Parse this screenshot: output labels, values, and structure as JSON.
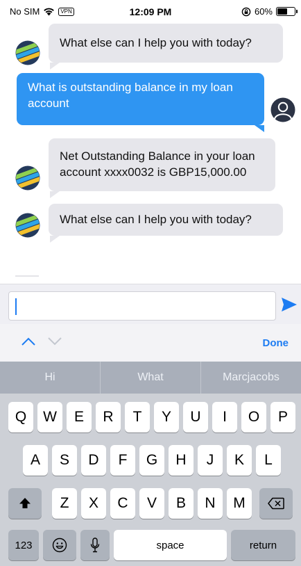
{
  "status_bar": {
    "carrier": "No SIM",
    "vpn": "VPN",
    "time": "12:09 PM",
    "battery": "60%",
    "battery_level": 0.6
  },
  "messages": [
    {
      "sender": "bot",
      "text": "What else can I help you with today?"
    },
    {
      "sender": "user",
      "text": "What is outstanding balance in my loan account"
    },
    {
      "sender": "bot",
      "text": "Net Outstanding Balance in your loan account xxxx0032 is GBP15,000.00"
    },
    {
      "sender": "bot",
      "text": "What else can I help you with today?"
    }
  ],
  "input": {
    "value": "",
    "placeholder": ""
  },
  "toolbar": {
    "done_label": "Done"
  },
  "keyboard": {
    "suggestions": [
      "Hi",
      "What",
      "Marcjacobs"
    ],
    "row1": [
      "Q",
      "W",
      "E",
      "R",
      "T",
      "Y",
      "U",
      "I",
      "O",
      "P"
    ],
    "row2": [
      "A",
      "S",
      "D",
      "F",
      "G",
      "H",
      "J",
      "K",
      "L"
    ],
    "row3": [
      "Z",
      "X",
      "C",
      "V",
      "B",
      "N",
      "M"
    ],
    "numbers_label": "123",
    "space_label": "space",
    "return_label": "return"
  },
  "colors": {
    "user_bubble": "#2f95f2",
    "bot_bubble": "#e6e6eb",
    "accent": "#1d7cf2"
  }
}
